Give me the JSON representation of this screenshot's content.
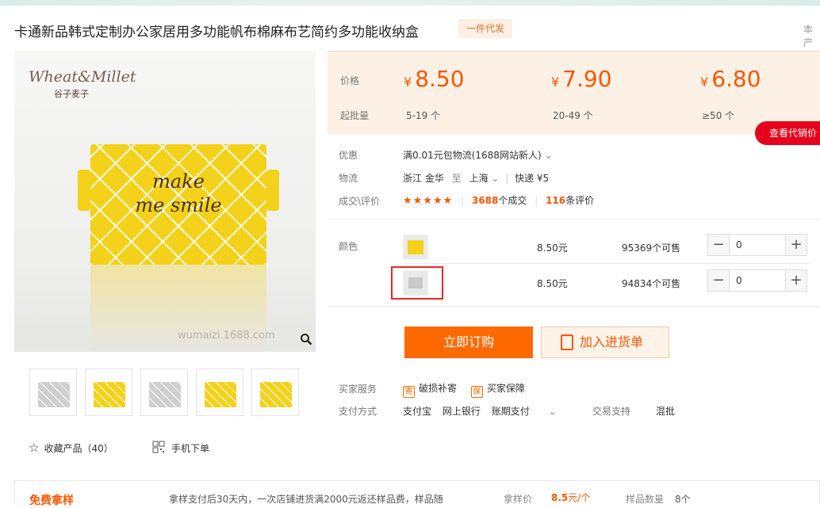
{
  "title": "卡通新品韩式定制办公家居用多功能帆布棉麻布艺简约多功能收纳盒",
  "tag": "一件代发",
  "header_right": "本产",
  "image": {
    "logo_text": "Wheat&Millet",
    "logo_sub": "谷子麦子",
    "box_text": "make me smile",
    "watermark": "wumaizi.1688.com",
    "zoom_icon": "magnifier-icon"
  },
  "thumbs": [
    "gray",
    "yellow",
    "gray",
    "yellow",
    "yellow"
  ],
  "actions": {
    "favorite": "收藏产品（40）",
    "mobile_order": "手机下单"
  },
  "price": {
    "price_label": "价格",
    "qty_label": "起批量",
    "tiers": [
      {
        "price": "8.50",
        "qty": "5-19 个"
      },
      {
        "price": "7.90",
        "qty": "20-49 个"
      },
      {
        "price": "6.80",
        "qty": "≥50 个"
      }
    ],
    "currency": "¥",
    "agent_button": "查看代销价"
  },
  "info": {
    "promo_label": "优惠",
    "promo_value": "满0.01元包物流(1688网站新人)",
    "logistics_label": "物流",
    "from": "浙江 金华",
    "to_word": "至",
    "dest": "上海",
    "express": "快递 ¥5",
    "deal_label": "成交\\评价",
    "stars": "★★★★★",
    "deals_count": "3688",
    "deals_unit": "个成交",
    "reviews_count": "116",
    "reviews_unit": "条评价"
  },
  "sku": {
    "label": "颜色",
    "rows": [
      {
        "price": "8.50元",
        "stock": "95369个可售",
        "qty": "0"
      },
      {
        "price": "8.50元",
        "stock": "94834个可售",
        "qty": "0"
      }
    ]
  },
  "buttons": {
    "buy": "立即订购",
    "cart": "加入进货单"
  },
  "service": {
    "label": "买家服务",
    "item1": "破损补寄",
    "item1_icon": "寄",
    "item2": "买家保障",
    "item2_icon": "保"
  },
  "payment": {
    "label": "支付方式",
    "methods": [
      "支付宝",
      "网上银行",
      "账期支付"
    ],
    "trade_label": "交易支持",
    "trade_value": "混批"
  },
  "bottom": {
    "brand": "免费拿样",
    "text": "拿样支付后30天内，一次店铺进货满2000元返还样品费，样品随",
    "price_label": "拿样价",
    "price": "8.5",
    "price_unit": "元/个",
    "count_label": "样品数量",
    "count": "8个"
  },
  "colors": {
    "accent": "#ff5500",
    "buy_bg": "#ff6a00",
    "price_bg": "#fdf1e6",
    "highlight": "#e8262a"
  }
}
